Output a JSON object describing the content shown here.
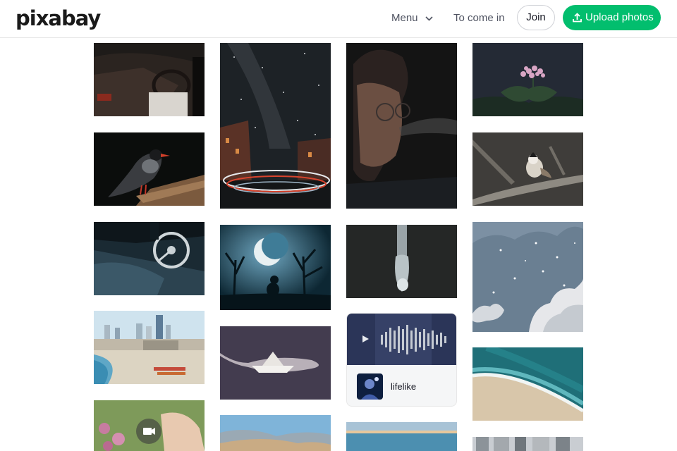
{
  "header": {
    "logo": "pixabay",
    "menu_label": "Menu",
    "login_label": "To come in",
    "join_label": "Join",
    "upload_label": "Upload photos"
  },
  "audio_card": {
    "artist": "lifelike"
  },
  "icons": {
    "menu_chevron": "chevron-down-icon",
    "upload": "upload-icon",
    "play": "play-icon",
    "video": "video-camera-icon"
  },
  "colors": {
    "accent": "#02be6e",
    "text": "#191b26",
    "muted": "#505462"
  }
}
